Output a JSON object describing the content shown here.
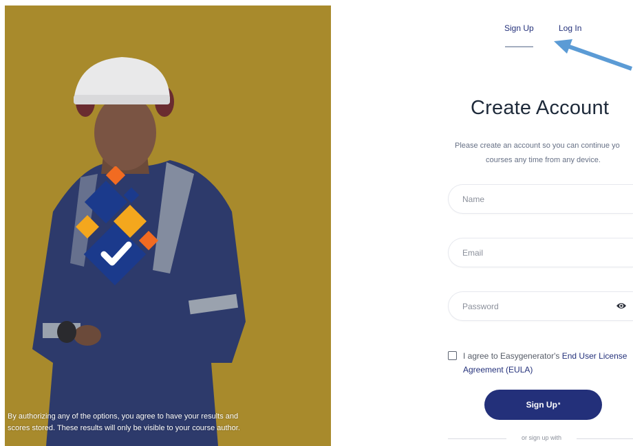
{
  "hero": {
    "disclaimer_line1": "By authorizing any of the options, you agree to have your results and",
    "disclaimer_line2": "scores stored. These results will only be visible to your course author.",
    "logo_icon": "checkmark-diamond-logo",
    "background_color": "#a88a2c"
  },
  "tabs": {
    "signup_label": "Sign Up",
    "login_label": "Log In",
    "active": "Sign Up"
  },
  "form": {
    "title": "Create Account",
    "subtitle_line1": "Please create an account so you can continue yo",
    "subtitle_line2": "courses any time from any device.",
    "name_placeholder": "Name",
    "email_placeholder": "Email",
    "password_placeholder": "Password",
    "password_toggle_icon": "eye-icon",
    "agree_prefix": "I agree to Easygenerator's ",
    "agree_link_part1": "End User License",
    "agree_link_part2": "Agreement (EULA)",
    "agree_checked": false,
    "submit_label": "Sign Up",
    "submit_mark": "*",
    "alt_signup_text": "or sign up with"
  },
  "colors": {
    "brand_navy": "#23307a",
    "arrow_blue": "#5b9bd5",
    "logo_orange": "#f26b21",
    "logo_yellow": "#f4a71d",
    "logo_navy": "#1b3a8c"
  }
}
